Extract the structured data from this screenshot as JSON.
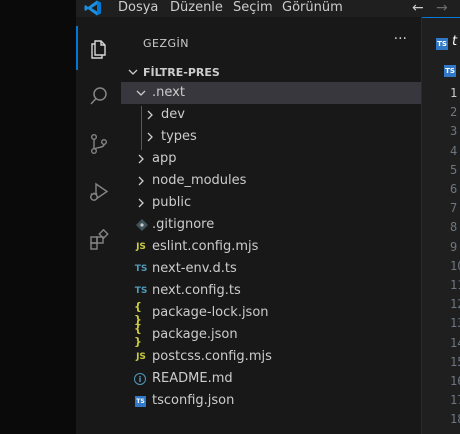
{
  "menu": [
    "Dosya",
    "Düzenle",
    "Seçim",
    "Görünüm"
  ],
  "sidebar": {
    "title": "GEZGİN",
    "more": "···",
    "section_title": "FİLTRE-PRES",
    "items": [
      {
        "label": ".next",
        "kind": "folder-open"
      },
      {
        "label": "dev",
        "kind": "folder"
      },
      {
        "label": "types",
        "kind": "folder"
      },
      {
        "label": "app",
        "kind": "folder"
      },
      {
        "label": "node_modules",
        "kind": "folder"
      },
      {
        "label": "public",
        "kind": "folder"
      },
      {
        "label": ".gitignore",
        "kind": "git"
      },
      {
        "label": "eslint.config.mjs",
        "kind": "js",
        "badge": "JS"
      },
      {
        "label": "next-env.d.ts",
        "kind": "ts",
        "badge": "TS"
      },
      {
        "label": "next.config.ts",
        "kind": "ts",
        "badge": "TS"
      },
      {
        "label": "package-lock.json",
        "kind": "json",
        "badge": "{ }"
      },
      {
        "label": "package.json",
        "kind": "json",
        "badge": "{ }"
      },
      {
        "label": "postcss.config.mjs",
        "kind": "js",
        "badge": "JS"
      },
      {
        "label": "README.md",
        "kind": "info",
        "badge": "i"
      },
      {
        "label": "tsconfig.json",
        "kind": "tsconfig",
        "badge": "TS"
      }
    ]
  },
  "editor": {
    "tab_name": "t",
    "tab_badge": "TS",
    "breadcrumb_badge": "TS",
    "line_numbers": [
      "1",
      "2",
      "3",
      "4",
      "5",
      "6",
      "7",
      "8",
      "9",
      "10",
      "11",
      "12",
      "13",
      "14",
      "15",
      "16",
      "17",
      "18"
    ]
  },
  "colors": {
    "accent": "#0078d4",
    "ts": "#3178c6",
    "js": "#cbcb41",
    "json": "#cbcb41",
    "info": "#519aba",
    "selected_row": "#37373d"
  }
}
